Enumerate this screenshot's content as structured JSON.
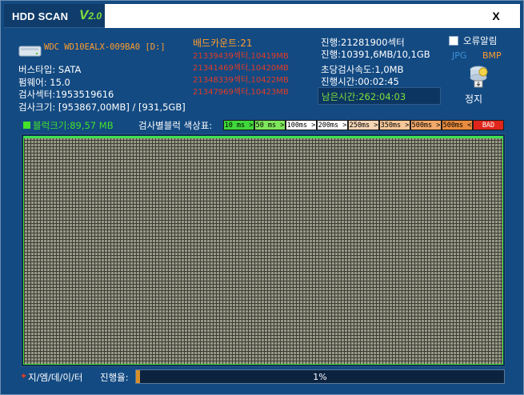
{
  "window": {
    "title": "HDD SCAN",
    "version_main": "V",
    "version_sub": "2.0",
    "close_label": "X"
  },
  "disk": {
    "model": "WDC WD10EALX-009BA0 [D:]",
    "bus_type": "버스타입: SATA",
    "firmware": "펌웨어: 15.0",
    "sectors": "검사섹터:1953519616",
    "size": "검사크기: [953867,00MB] / [931,5GB]"
  },
  "bad": {
    "count_label": "배드카운트:21",
    "entries": [
      "21339439섹터,10419MB",
      "21341469섹터,10420MB",
      "21348339섹터,10422MB",
      "21347969섹터,10423MB"
    ]
  },
  "progress_info": {
    "sector": "진행:21281900섹터",
    "mb": "진행:10391,6MB/10,1GB",
    "speed": "초당검사속도:1,0MB",
    "elapsed": "진행시간:00:02:45",
    "remaining": "남은시간:262:04:03"
  },
  "controls": {
    "alert_label": "오류알림",
    "jpg_label": "JPG",
    "bmp_label": "BMP",
    "stop_label": "정지"
  },
  "legend": {
    "block_size": "블럭크기:89,57 MB",
    "label": "검사별블럭 색상표:",
    "items": [
      {
        "text": "10 ms >",
        "bg": "#3fd83a"
      },
      {
        "text": "50 ms >",
        "bg": "#7ee65b"
      },
      {
        "text": "100ms >",
        "bg": "#ffffff"
      },
      {
        "text": "200ms >",
        "bg": "#ffffff"
      },
      {
        "text": "250ms >",
        "bg": "#f3d6b5"
      },
      {
        "text": "350ms >",
        "bg": "#f6c89a"
      },
      {
        "text": "500ms >",
        "bg": "#f2a969"
      },
      {
        "text": "500ms <",
        "bg": "#e88b3e"
      },
      {
        "text": "BAD",
        "bg": "#e0261c"
      }
    ]
  },
  "footer": {
    "brand": "지/엠/데/이/터",
    "progress_label": "진행율:",
    "progress_text": "1%",
    "progress_fraction": 0.01
  },
  "colors": {
    "accent_green": "#44e22a",
    "accent_orange": "#ff9d2e",
    "accent_red": "#e23c26"
  }
}
